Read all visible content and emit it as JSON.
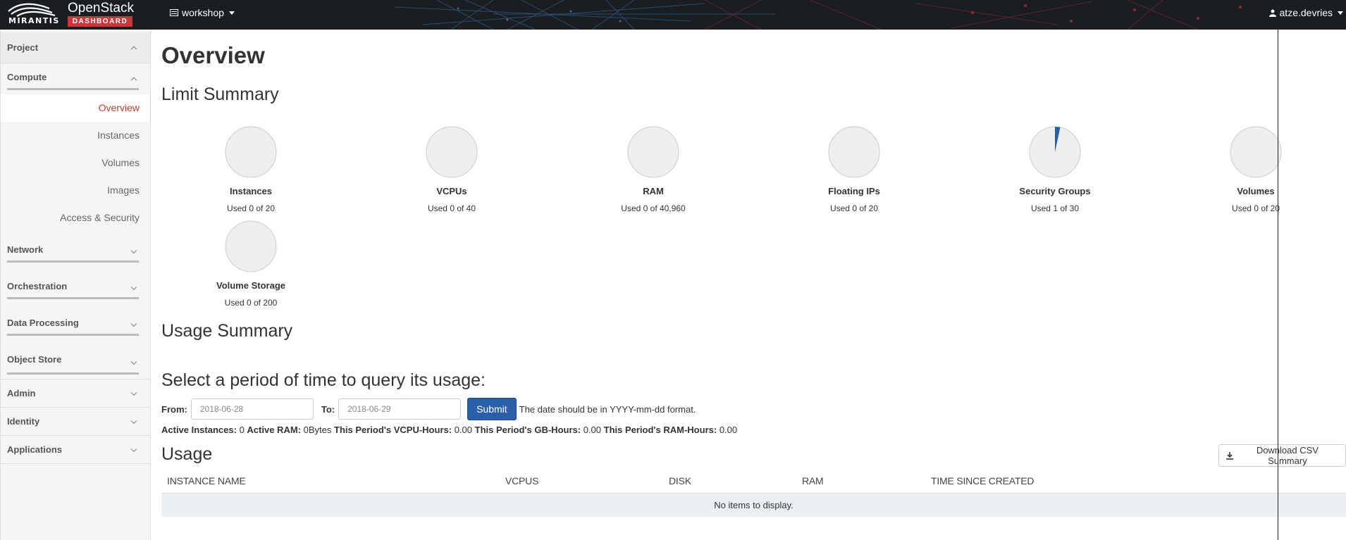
{
  "header": {
    "brand_company": "MIRANTIS",
    "brand_product": "OpenStack",
    "brand_badge": "DASHBOARD",
    "project_name": "workshop",
    "user_name": "atze.devries",
    "colors": {
      "bar": "#1a1d22",
      "badge": "#d0343b"
    }
  },
  "sidebar": {
    "project": "Project",
    "compute": "Compute",
    "compute_items": [
      "Overview",
      "Instances",
      "Volumes",
      "Images",
      "Access & Security"
    ],
    "sections": [
      "Network",
      "Orchestration",
      "Data Processing",
      "Object Store"
    ],
    "bottom": [
      "Admin",
      "Identity",
      "Applications"
    ],
    "active": "Overview"
  },
  "main": {
    "page_title": "Overview",
    "limit_summary_title": "Limit Summary",
    "usage_summary_title": "Usage Summary",
    "query_title": "Select a period of time to query its usage:",
    "usage_title": "Usage"
  },
  "limits": [
    {
      "title": "Instances",
      "used_text": "Used 0 of 20",
      "used": 0,
      "total": 20
    },
    {
      "title": "VCPUs",
      "used_text": "Used 0 of 40",
      "used": 0,
      "total": 40
    },
    {
      "title": "RAM",
      "used_text": "Used 0 of 40,960",
      "used": 0,
      "total": 40960
    },
    {
      "title": "Floating IPs",
      "used_text": "Used 0 of 20",
      "used": 0,
      "total": 20
    },
    {
      "title": "Security Groups",
      "used_text": "Used 1 of 30",
      "used": 1,
      "total": 30
    },
    {
      "title": "Volumes",
      "used_text": "Used 0 of 20",
      "used": 0,
      "total": 20
    },
    {
      "title": "Volume Storage",
      "used_text": "Used 0 of 200",
      "used": 0,
      "total": 200
    }
  ],
  "form": {
    "from_label": "From:",
    "from_value": "2018-06-28",
    "to_label": "To:",
    "to_value": "2018-06-29",
    "submit_label": "Submit",
    "hint": "The date should be in YYYY-mm-dd format."
  },
  "stats": {
    "active_instances_label": "Active Instances:",
    "active_instances": "0",
    "active_ram_label": "Active RAM:",
    "active_ram": "0Bytes",
    "vcpu_hours_label": "This Period's VCPU-Hours:",
    "vcpu_hours": "0.00",
    "gb_hours_label": "This Period's GB-Hours:",
    "gb_hours": "0.00",
    "ram_hours_label": "This Period's RAM-Hours:",
    "ram_hours": "0.00"
  },
  "table": {
    "download_label": "Download CSV Summary",
    "columns": [
      "INSTANCE NAME",
      "VCPUS",
      "DISK",
      "RAM",
      "TIME SINCE CREATED"
    ],
    "empty_text": "No items to display."
  },
  "colors": {
    "pie_used": "#2a5ea8",
    "pie_free": "#eeeeee",
    "active_link": "#c0392b"
  }
}
